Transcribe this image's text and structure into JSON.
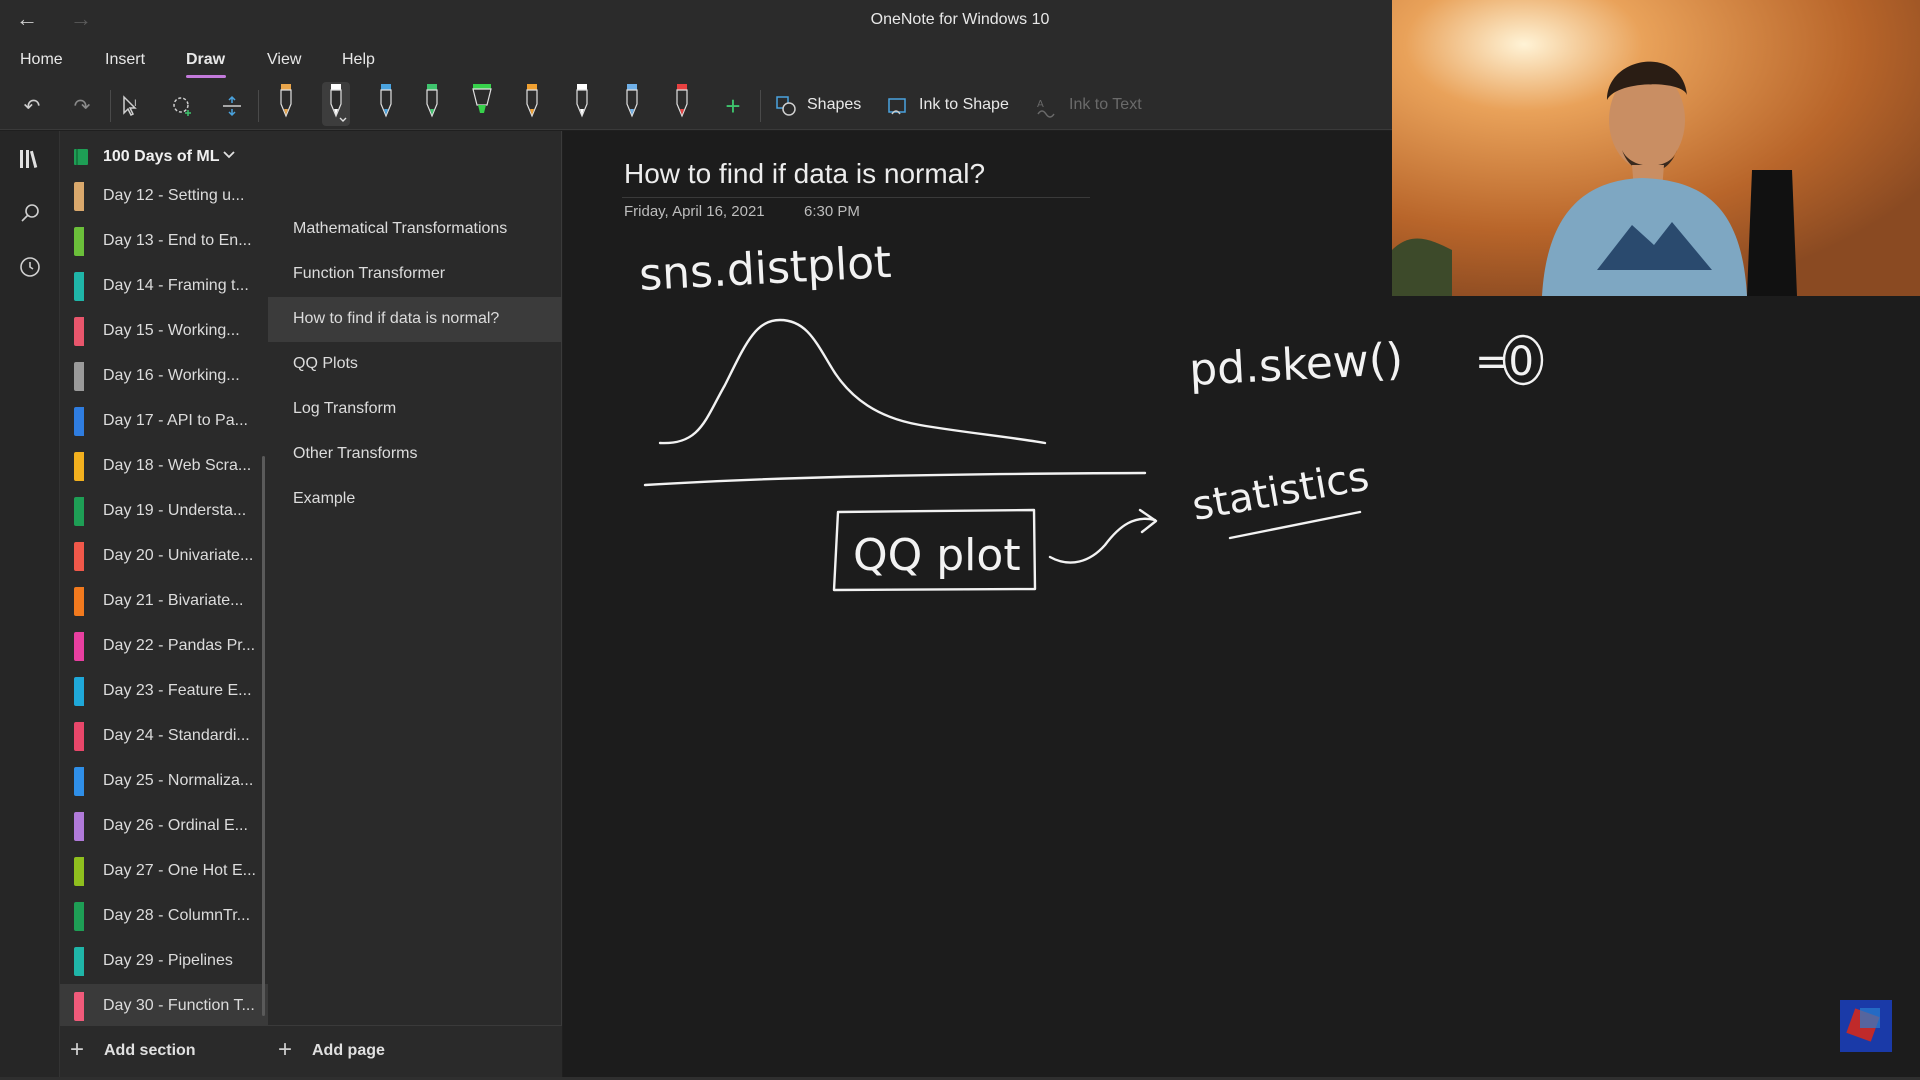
{
  "titlebar": {
    "app_title": "OneNote for Windows 10",
    "back_icon": "back-arrow-icon",
    "forward_icon": "forward-arrow-icon"
  },
  "menu": {
    "items": [
      "Home",
      "Insert",
      "Draw",
      "View",
      "Help"
    ],
    "active": "Draw",
    "accent": "#c37adb"
  },
  "toolbar": {
    "shapes_label": "Shapes",
    "ink_to_shape_label": "Ink to Shape",
    "ink_to_text_label": "Ink to Text",
    "pen_colors": [
      "#e8a54b",
      "#ffffff",
      "#4aa3df",
      "#3ec46d",
      "#37d14b",
      "#f0a030",
      "#ffffff",
      "#6fb0e8",
      "#e84040"
    ]
  },
  "notebook": {
    "title": "100 Days of ML"
  },
  "sections": [
    {
      "label": "Day 12 - Setting u...",
      "color": "#d9a86c"
    },
    {
      "label": "Day 13 - End to En...",
      "color": "#6bbf3a"
    },
    {
      "label": "Day 14 - Framing t...",
      "color": "#1fb5a8"
    },
    {
      "label": "Day 15 - Working...",
      "color": "#e8566c"
    },
    {
      "label": "Day 16 - Working...",
      "color": "#9a9a9a"
    },
    {
      "label": "Day 17 - API to Pa...",
      "color": "#2f7de0"
    },
    {
      "label": "Day 18 - Web Scra...",
      "color": "#f2b01e"
    },
    {
      "label": "Day 19 - Understa...",
      "color": "#1e9e55"
    },
    {
      "label": "Day 20 - Univariate...",
      "color": "#f0584a"
    },
    {
      "label": "Day 21 - Bivariate...",
      "color": "#f27a1e"
    },
    {
      "label": "Day 22 - Pandas Pr...",
      "color": "#e83fa0"
    },
    {
      "label": "Day 23 - Feature E...",
      "color": "#1fa8d9"
    },
    {
      "label": "Day 24 - Standardi...",
      "color": "#e8476a"
    },
    {
      "label": "Day 25 - Normaliza...",
      "color": "#2f8fe8"
    },
    {
      "label": "Day 26 - Ordinal E...",
      "color": "#b07ad9"
    },
    {
      "label": "Day 27 - One Hot E...",
      "color": "#8fbf1e"
    },
    {
      "label": "Day 28 - ColumnTr...",
      "color": "#1e9e55"
    },
    {
      "label": "Day 29 - Pipelines",
      "color": "#1fb5a8"
    },
    {
      "label": "Day 30 - Function T...",
      "color": "#f05a7a"
    }
  ],
  "selected_section": "Day 30 - Function T...",
  "pages": [
    "Mathematical Transformations",
    "Function Transformer",
    "How to find if data is normal?",
    "QQ Plots",
    "Log Transform",
    "Other Transforms",
    "Example"
  ],
  "selected_page": "How to find if data is normal?",
  "bottom": {
    "add_section": "Add section",
    "add_page": "Add page"
  },
  "note": {
    "title": "How to find if data is normal?",
    "date": "Friday, April 16, 2021",
    "time": "6:30 PM",
    "ink_texts": [
      "sns.distplot",
      "pd.skew()",
      "=0",
      "QQ plot",
      "statistics"
    ]
  }
}
